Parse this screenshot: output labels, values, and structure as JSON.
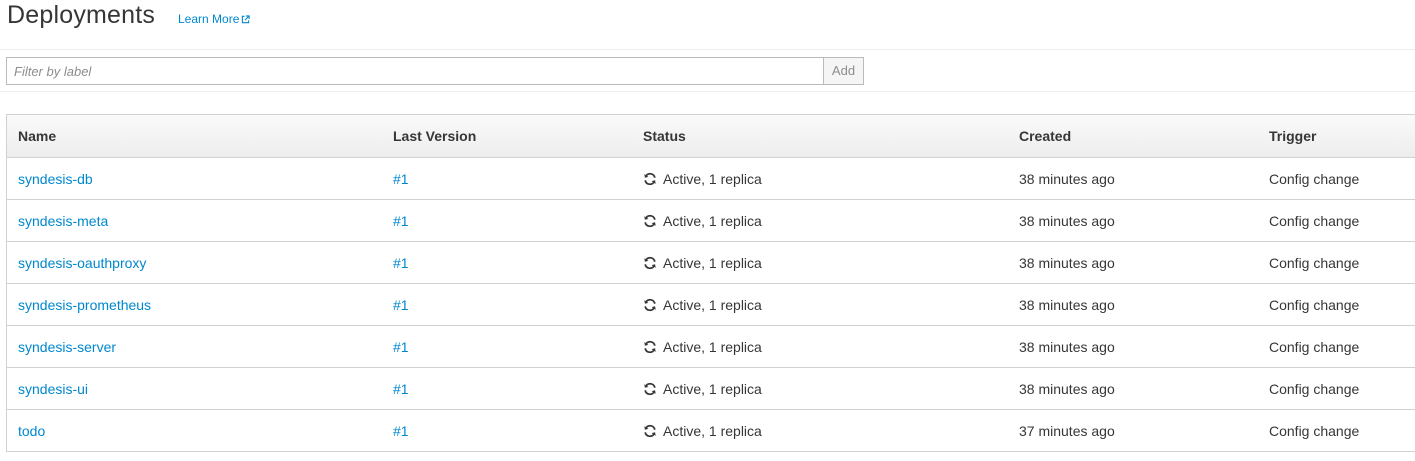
{
  "header": {
    "title": "Deployments",
    "learn_more": "Learn More"
  },
  "filter": {
    "placeholder": "Filter by label",
    "add_label": "Add"
  },
  "table": {
    "columns": {
      "name": "Name",
      "last_version": "Last Version",
      "status": "Status",
      "created": "Created",
      "trigger": "Trigger"
    },
    "rows": [
      {
        "name": "syndesis-db",
        "version": "#1",
        "status": "Active, 1 replica",
        "created": "38 minutes ago",
        "trigger": "Config change"
      },
      {
        "name": "syndesis-meta",
        "version": "#1",
        "status": "Active, 1 replica",
        "created": "38 minutes ago",
        "trigger": "Config change"
      },
      {
        "name": "syndesis-oauthproxy",
        "version": "#1",
        "status": "Active, 1 replica",
        "created": "38 minutes ago",
        "trigger": "Config change"
      },
      {
        "name": "syndesis-prometheus",
        "version": "#1",
        "status": "Active, 1 replica",
        "created": "38 minutes ago",
        "trigger": "Config change"
      },
      {
        "name": "syndesis-server",
        "version": "#1",
        "status": "Active, 1 replica",
        "created": "38 minutes ago",
        "trigger": "Config change"
      },
      {
        "name": "syndesis-ui",
        "version": "#1",
        "status": "Active, 1 replica",
        "created": "38 minutes ago",
        "trigger": "Config change"
      },
      {
        "name": "todo",
        "version": "#1",
        "status": "Active, 1 replica",
        "created": "37 minutes ago",
        "trigger": "Config change"
      }
    ]
  },
  "icons": {
    "learn_more": "external-link-icon",
    "status": "sync-icon"
  },
  "colors": {
    "link": "#0088ce",
    "text": "#363636",
    "border": "#d1d1d1"
  }
}
